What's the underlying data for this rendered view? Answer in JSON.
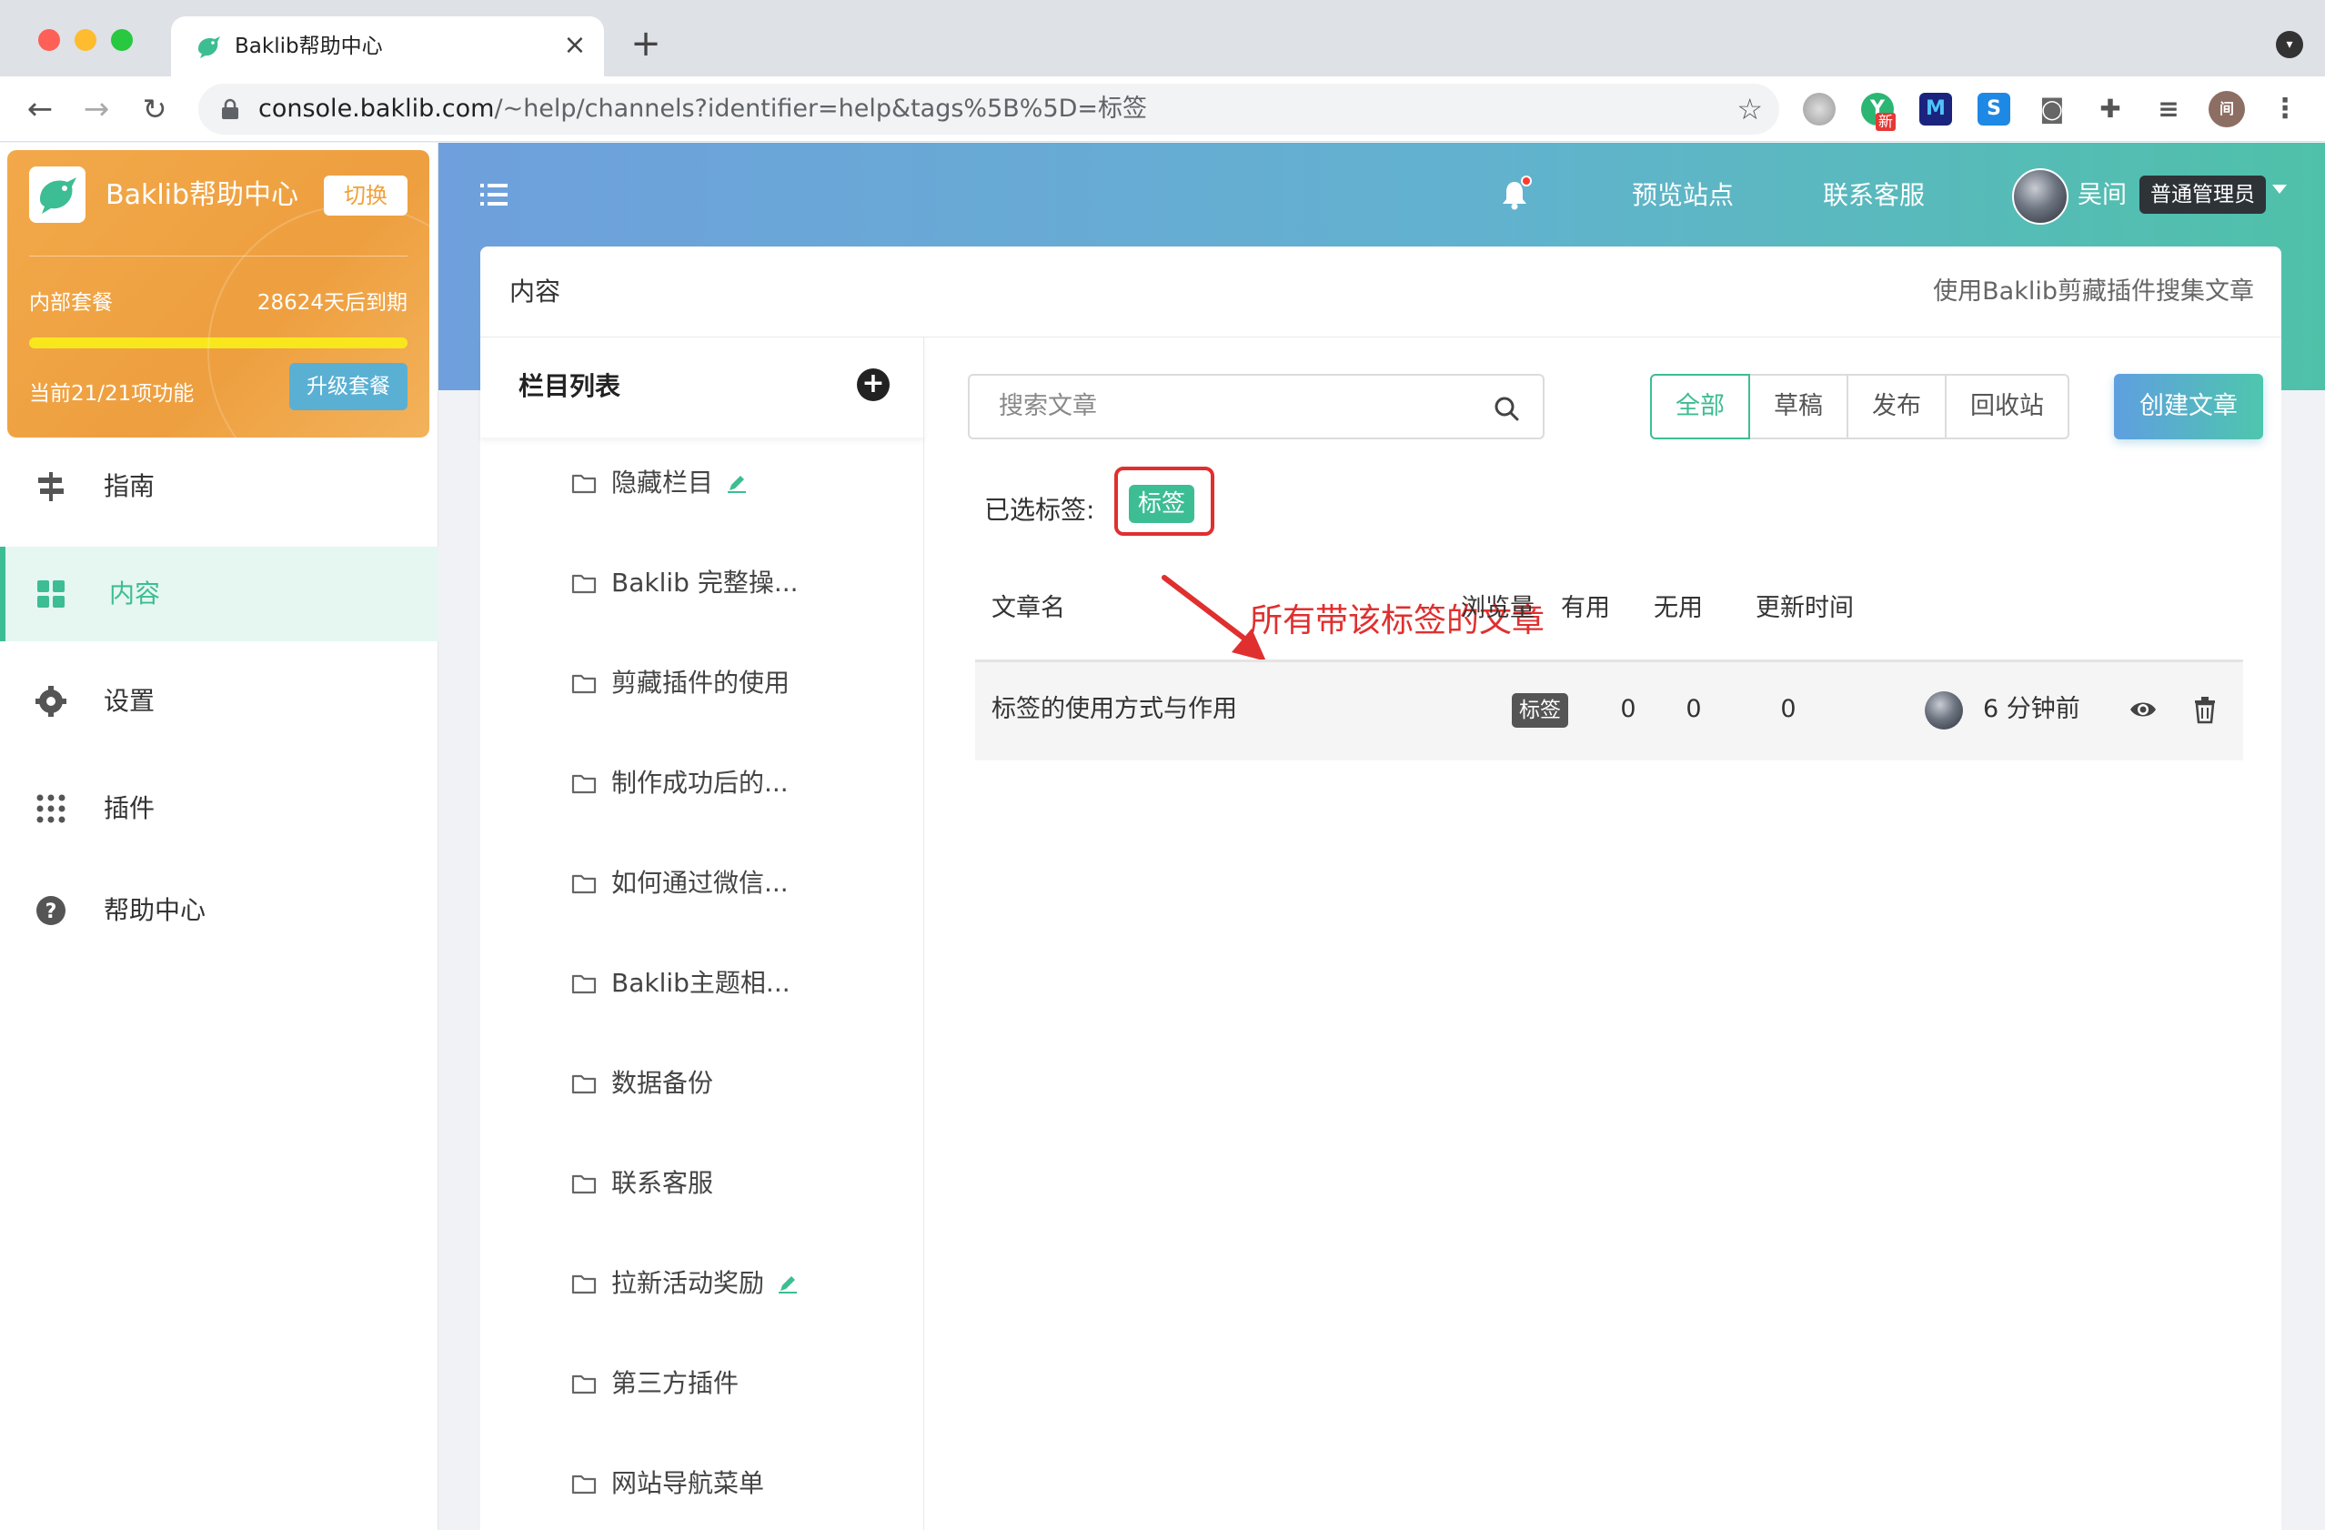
{
  "browser": {
    "tab_title": "Baklib帮助中心",
    "tab_close": "×",
    "new_tab": "+",
    "url_host": "console.baklib.com",
    "url_path": "/~help/channels?identifier=help&tags%5B%5D=标签",
    "ext_new_badge": "新",
    "ext_m_label": "M",
    "ext_s_label": "S",
    "profile_initial": "间"
  },
  "sidebar": {
    "brand_name": "Baklib帮助中心",
    "switch_label": "切换",
    "plan_name": "内部套餐",
    "plan_expire": "28624天后到期",
    "plan_usage_ratio": 1.0,
    "plan_features": "当前21/21项功能",
    "upgrade_label": "升级套餐",
    "nav": [
      {
        "label": "指南",
        "icon": "signpost-icon"
      },
      {
        "label": "内容",
        "icon": "grid-icon",
        "active": true
      },
      {
        "label": "设置",
        "icon": "gear-icon"
      },
      {
        "label": "插件",
        "icon": "apps-dots-icon"
      },
      {
        "label": "帮助中心",
        "icon": "help-circle-icon"
      }
    ]
  },
  "header": {
    "preview_site": "预览站点",
    "contact_support": "联系客服",
    "user_name": "吴间",
    "user_role": "普通管理员"
  },
  "content": {
    "title": "内容",
    "tip": "使用Baklib剪藏插件搜集文章"
  },
  "channels": {
    "title": "栏目列表",
    "add_label": "+",
    "items": [
      {
        "label": "隐藏栏目",
        "edit": true
      },
      {
        "label": "Baklib 完整操..."
      },
      {
        "label": "剪藏插件的使用"
      },
      {
        "label": "制作成功后的..."
      },
      {
        "label": "如何通过微信..."
      },
      {
        "label": "Baklib主题相..."
      },
      {
        "label": "数据备份"
      },
      {
        "label": "联系客服"
      },
      {
        "label": "拉新活动奖励",
        "edit": true
      },
      {
        "label": "第三方插件"
      },
      {
        "label": "网站导航菜单"
      }
    ]
  },
  "articles": {
    "search_placeholder": "搜索文章",
    "filters": [
      "全部",
      "草稿",
      "发布",
      "回收站"
    ],
    "active_filter": "全部",
    "create_label": "创建文章",
    "selected_tags_label": "已选标签:",
    "selected_tag": "标签",
    "annotation": "所有带该标签的文章",
    "columns": {
      "name": "文章名",
      "views": "浏览量",
      "useful": "有用",
      "useless": "无用",
      "updated": "更新时间"
    },
    "rows": [
      {
        "title": "标签的使用方式与作用",
        "tag": "标签",
        "views": "0",
        "useful": "0",
        "useless": "0",
        "updated": "6 分钟前"
      }
    ]
  },
  "colors": {
    "accent": "#3dbd93",
    "brand_orange": "#ee9f3f",
    "annotation_red": "#e02f2f"
  }
}
